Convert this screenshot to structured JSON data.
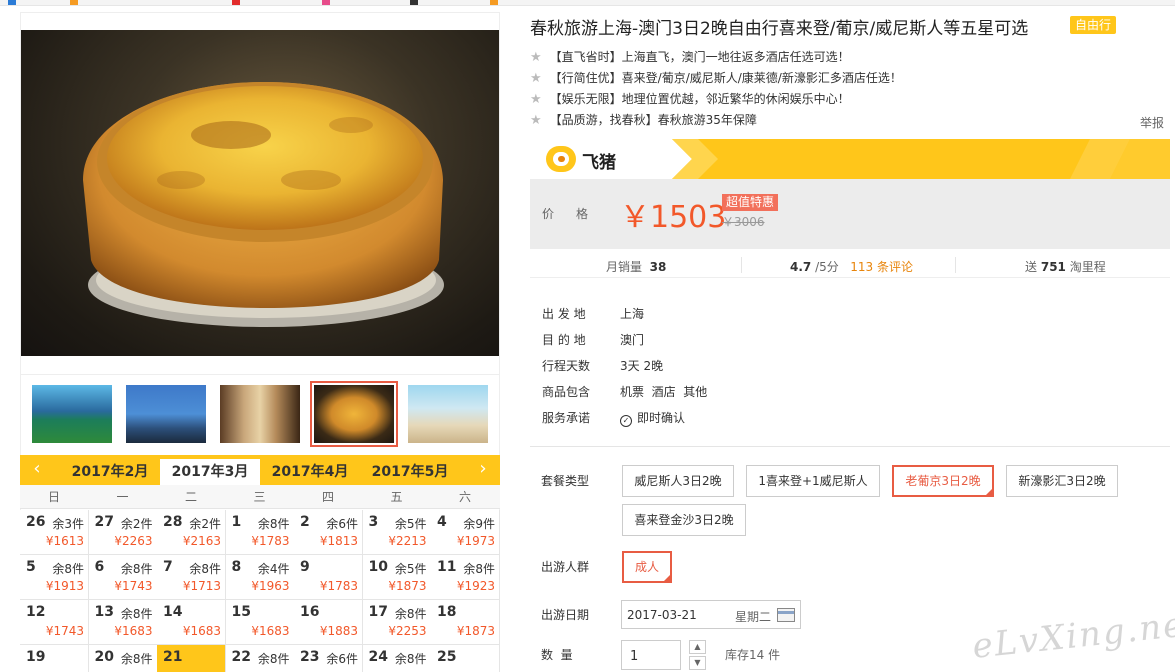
{
  "title": "春秋旅游上海-澳门3日2晚自由行喜来登/葡京/威尼斯人等五星可选",
  "title_tag": "自由行",
  "features": [
    "【直飞省时】上海直飞，澳门一地往返多酒店任选可选！",
    "【行简住优】喜来登/葡京/威尼斯人/康莱德/新濠影汇多酒店任选！",
    "【娱乐无限】地理位置优越，邻近繁华的休闲娱乐中心！",
    "【品质游，找春秋】春秋旅游35年保障"
  ],
  "report_label": "举报",
  "brand": {
    "name": "飞猪",
    "logo_glyph": "ᐅ"
  },
  "price": {
    "label": "价格",
    "value": "￥1503",
    "badge": "超值特惠",
    "old": "￥3006"
  },
  "stats": {
    "monthly_sales_label": "月销量",
    "monthly_sales": "38",
    "rating": "4.7",
    "rating_suffix": "/5分",
    "reviews": "113 条评论",
    "mileage_prefix": "送",
    "mileage": "751",
    "mileage_suffix": "淘里程"
  },
  "info": [
    {
      "key": "出 发 地",
      "value": "上海"
    },
    {
      "key": "目 的 地",
      "value": "澳门"
    },
    {
      "key": "行程天数",
      "value": "3天 2晚"
    },
    {
      "key": "商品包含",
      "value": "机票  酒店  其他"
    },
    {
      "key": "服务承诺",
      "value": "即时确认"
    }
  ],
  "package": {
    "label": "套餐类型",
    "options": [
      "威尼斯人3日2晚",
      "1喜来登+1威尼斯人",
      "老葡京3日2晚",
      "新濠影汇3日2晚",
      "喜来登金沙3日2晚"
    ],
    "selected": "老葡京3日2晚"
  },
  "group": {
    "label": "出游人群",
    "options": [
      "成人"
    ],
    "selected": "成人"
  },
  "date": {
    "label": "出游日期",
    "value": "2017-03-21",
    "weekday": "星期二"
  },
  "quantity": {
    "label": "数  量",
    "value": "1",
    "stock": "库存14 件"
  },
  "calendar": {
    "months": [
      "2017年2月",
      "2017年3月",
      "2017年4月",
      "2017年5月"
    ],
    "active_month": "2017年3月",
    "weekdays": [
      "日",
      "一",
      "二",
      "三",
      "四",
      "五",
      "六"
    ],
    "rows": [
      [
        {
          "d": "26",
          "s": "余3件",
          "p": "¥1613"
        },
        {
          "d": "27",
          "s": "余2件",
          "p": "¥2263"
        },
        {
          "d": "28",
          "s": "余2件",
          "p": "¥2163"
        },
        {
          "d": "1",
          "s": "余8件",
          "p": "¥1783"
        },
        {
          "d": "2",
          "s": "余6件",
          "p": "¥1813"
        },
        {
          "d": "3",
          "s": "余5件",
          "p": "¥2213"
        },
        {
          "d": "4",
          "s": "余9件",
          "p": "¥1973"
        }
      ],
      [
        {
          "d": "5",
          "s": "余8件",
          "p": "¥1913"
        },
        {
          "d": "6",
          "s": "余8件",
          "p": "¥1743"
        },
        {
          "d": "7",
          "s": "余8件",
          "p": "¥1713"
        },
        {
          "d": "8",
          "s": "余4件",
          "p": "¥1963"
        },
        {
          "d": "9",
          "s": "",
          "p": "¥1783"
        },
        {
          "d": "10",
          "s": "余5件",
          "p": "¥1873"
        },
        {
          "d": "11",
          "s": "余8件",
          "p": "¥1923"
        }
      ],
      [
        {
          "d": "12",
          "s": "",
          "p": "¥1743"
        },
        {
          "d": "13",
          "s": "余8件",
          "p": "¥1683"
        },
        {
          "d": "14",
          "s": "",
          "p": "¥1683"
        },
        {
          "d": "15",
          "s": "",
          "p": "¥1683"
        },
        {
          "d": "16",
          "s": "",
          "p": "¥1883"
        },
        {
          "d": "17",
          "s": "余8件",
          "p": "¥2253"
        },
        {
          "d": "18",
          "s": "",
          "p": "¥1873"
        }
      ],
      [
        {
          "d": "19",
          "s": "",
          "p": ""
        },
        {
          "d": "20",
          "s": "余8件",
          "p": ""
        },
        {
          "d": "21",
          "s": "",
          "p": "",
          "today": true
        },
        {
          "d": "22",
          "s": "余8件",
          "p": ""
        },
        {
          "d": "23",
          "s": "余6件",
          "p": ""
        },
        {
          "d": "24",
          "s": "余8件",
          "p": ""
        },
        {
          "d": "25",
          "s": "",
          "p": ""
        }
      ]
    ]
  },
  "watermark": "eLvXing.net",
  "colors": {
    "accent": "#ffc61a",
    "price": "#f2582a",
    "selected": "#e85c43"
  }
}
